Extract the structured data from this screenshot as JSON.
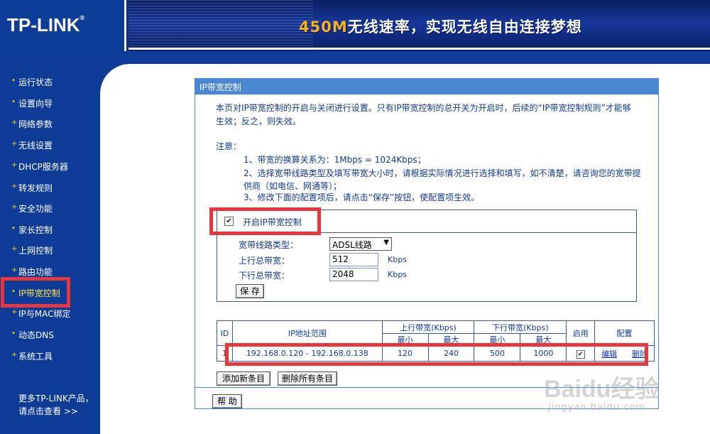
{
  "header": {
    "logo": "TP-LINK",
    "logo_reg": "®",
    "slogan_speed": "450M",
    "slogan_rest": "无线速率，实现无线自由连接梦想"
  },
  "sidebar": {
    "items": [
      {
        "label": "运行状态"
      },
      {
        "label": "设置向导"
      },
      {
        "label": "网络参数"
      },
      {
        "label": "无线设置"
      },
      {
        "label": "DHCP服务器"
      },
      {
        "label": "转发规则"
      },
      {
        "label": "安全功能"
      },
      {
        "label": "家长控制"
      },
      {
        "label": "上网控制"
      },
      {
        "label": "路由功能"
      },
      {
        "label": "IP带宽控制",
        "active": true
      },
      {
        "label": "IP与MAC绑定"
      },
      {
        "label": "动态DNS"
      },
      {
        "label": "系统工具"
      }
    ],
    "more_line1": "更多TP-LINK产品，",
    "more_line2": "请点击查看 >>"
  },
  "panel": {
    "title": "IP带宽控制",
    "intro1": "本页对IP带宽控制的开启与关闭进行设置。只有IP带宽控制的总开关为开启时，后续的“IP带宽控制规则”才能够",
    "intro2": "生效；反之，则失效。",
    "note_label": "注意：",
    "note1": "1、带宽的换算关系为：1Mbps = 1024Kbps；",
    "note2a": "2、选择宽带线路类型及填写带宽大小时，请根据实际情况进行选择和填写，如不清楚，请咨询您的宽带提",
    "note2b": "供商（如电信、网通等）；",
    "note3": "3、修改下面的配置项后，请点击“保存”按钮，使配置项生效。"
  },
  "config": {
    "enable_label": "开启IP带宽控制",
    "enable_checked": true,
    "line_type_label": "宽带线路类型：",
    "line_type_value": "ADSL线路",
    "up_label": "上行总带宽：",
    "up_value": "512",
    "down_label": "下行总带宽：",
    "down_value": "2048",
    "unit": "Kbps",
    "save_label": "保 存"
  },
  "rules": {
    "headers": {
      "id": "ID",
      "ip_range": "IP地址范围",
      "up": "上行带宽(Kbps)",
      "down": "下行带宽(Kbps)",
      "min": "最小",
      "max": "最大",
      "enable": "启用",
      "config": "配置"
    },
    "rows": [
      {
        "id": "1",
        "ip_range": "192.168.0.120 - 192.168.0.138",
        "up_min": "120",
        "up_max": "240",
        "down_min": "500",
        "down_max": "1000",
        "enabled": true,
        "edit": "编辑",
        "delete": "删除"
      }
    ],
    "add_label": "添加新条目",
    "delete_all_label": "删除所有条目"
  },
  "help_label": "帮 助",
  "watermark": {
    "brand": "Baidu经验",
    "url": "jingyan.baidu.com"
  },
  "colors": {
    "sidebar_bg": "#0e3b96",
    "panel_accent": "#4a86d2",
    "highlight": "#e8363e",
    "text": "#123a89"
  }
}
